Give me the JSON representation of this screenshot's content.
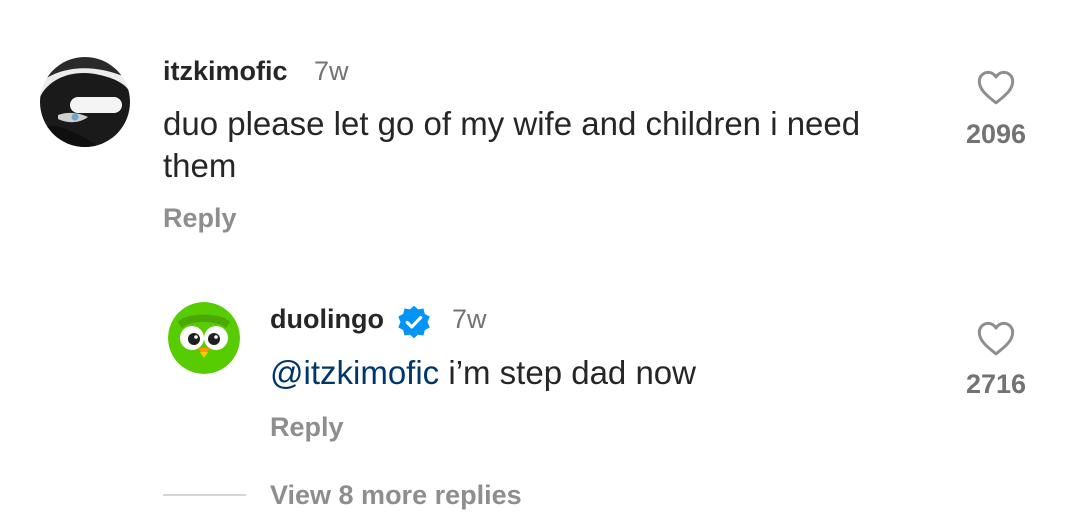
{
  "comment": {
    "username": "itzkimofic",
    "time": "7w",
    "text_line1": "duo please let go of my wife and children i need",
    "text_line2": "them",
    "reply_label": "Reply",
    "likes": "2096",
    "like_icon": "heart-outline-icon"
  },
  "reply": {
    "username": "duolingo",
    "verified_icon": "verified-badge-icon",
    "time": "7w",
    "mention": "@itzkimofic",
    "text": " i’m step dad now",
    "reply_label": "Reply",
    "likes": "2716",
    "like_icon": "heart-outline-icon",
    "avatar_color": "#58cc02"
  },
  "thread": {
    "view_more_label": "View 8 more replies"
  },
  "colors": {
    "mention": "#00376b",
    "muted": "#8e8e8e",
    "verified": "#0095f6"
  }
}
